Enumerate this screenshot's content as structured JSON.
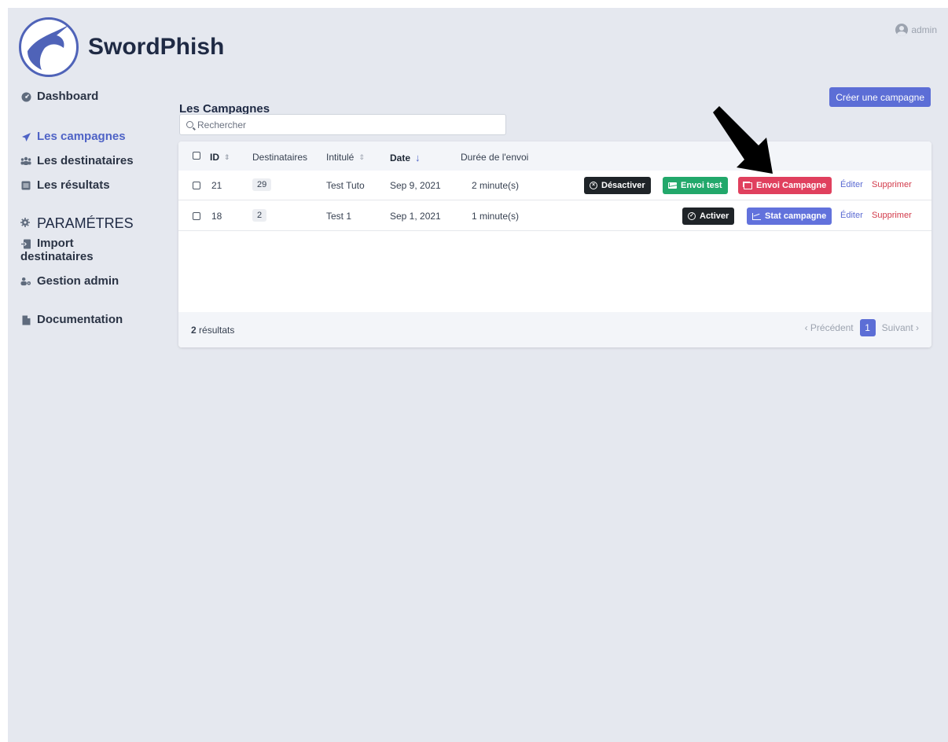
{
  "app": {
    "title": "SwordPhish"
  },
  "user": {
    "name": "admin",
    "icon": "user-circle-icon"
  },
  "sidebar": {
    "items": [
      {
        "label": "Dashboard",
        "icon": "dashboard-icon"
      },
      {
        "label": "Les campagnes",
        "icon": "paper-plane-icon",
        "active": true
      },
      {
        "label": "Les destinataires",
        "icon": "users-icon"
      },
      {
        "label": "Les résultats",
        "icon": "table-icon"
      }
    ],
    "section": {
      "label": "PARAMÉTRES",
      "icon": "gear-icon"
    },
    "settings_items": [
      {
        "label_line1": "Import",
        "label_line2": "destinataires",
        "icon": "import-icon"
      },
      {
        "label": "Gestion admin",
        "icon": "users-gear-icon"
      }
    ],
    "documentation": {
      "label": "Documentation",
      "icon": "file-icon"
    }
  },
  "main": {
    "title": "Les Campagnes",
    "create_button": "Créer une campagne",
    "search_placeholder": "Rechercher",
    "columns": [
      "ID",
      "Destinataires",
      "Intitulé",
      "Date",
      "Durée de l'envoi"
    ],
    "rows": [
      {
        "id": "21",
        "destinataires": "29",
        "intitule": "Test Tuto",
        "date": "Sep 9, 2021",
        "duree": "2 minute(s)",
        "buttons": {
          "toggle": "Désactiver",
          "test": "Envoi test",
          "campaign": "Envoi Campagne"
        },
        "edit": "Éditer",
        "delete": "Supprimer"
      },
      {
        "id": "18",
        "destinataires": "2",
        "intitule": "Test 1",
        "date": "Sep 1, 2021",
        "duree": "1 minute(s)",
        "buttons": {
          "toggle": "Activer",
          "stat": "Stat campagne"
        },
        "edit": "Éditer",
        "delete": "Supprimer"
      }
    ],
    "footer": {
      "count": "2",
      "count_label": " résultats",
      "prev": "Précédent",
      "page": "1",
      "next": "Suivant"
    }
  },
  "colors": {
    "accent": "#5c6ed6",
    "danger": "#e0405e",
    "success": "#22a86b",
    "dark": "#1f2428"
  }
}
